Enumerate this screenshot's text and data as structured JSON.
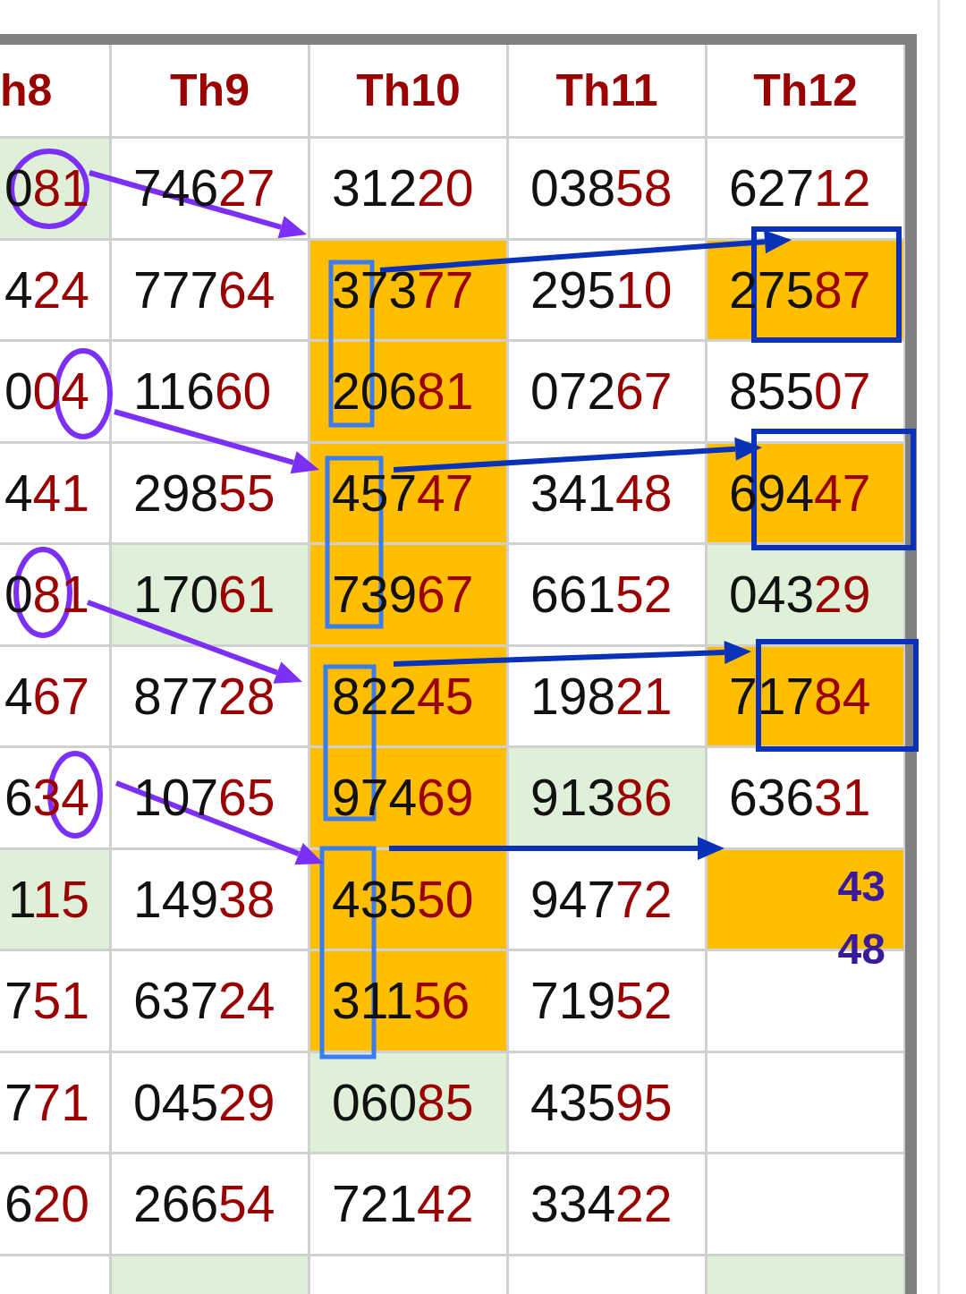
{
  "table": {
    "columns": [
      {
        "label": "h8"
      },
      {
        "label": "Th9"
      },
      {
        "label": "Th10"
      },
      {
        "label": "Th11"
      },
      {
        "label": "Th12"
      }
    ],
    "rows": [
      {
        "cells": [
          {
            "kind": "number",
            "text": "081",
            "color": "#dff0d8"
          },
          {
            "kind": "number",
            "text": "74627"
          },
          {
            "kind": "number",
            "text": "31220"
          },
          {
            "kind": "number",
            "text": "03858"
          },
          {
            "kind": "number",
            "text": "62712"
          }
        ]
      },
      {
        "cells": [
          {
            "kind": "number",
            "text": "424"
          },
          {
            "kind": "number",
            "text": "77764"
          },
          {
            "kind": "number",
            "text": "37377",
            "color": "#ffbf00"
          },
          {
            "kind": "number",
            "text": "29510"
          },
          {
            "kind": "number",
            "text": "27587",
            "color": "#ffbf00"
          }
        ]
      },
      {
        "cells": [
          {
            "kind": "number",
            "text": "004"
          },
          {
            "kind": "number",
            "text": "11660"
          },
          {
            "kind": "number",
            "text": "20681",
            "color": "#ffbf00"
          },
          {
            "kind": "number",
            "text": "07267"
          },
          {
            "kind": "number",
            "text": "85507"
          }
        ]
      },
      {
        "cells": [
          {
            "kind": "number",
            "text": "441"
          },
          {
            "kind": "number",
            "text": "29855"
          },
          {
            "kind": "number",
            "text": "45747",
            "color": "#ffbf00"
          },
          {
            "kind": "number",
            "text": "34148"
          },
          {
            "kind": "number",
            "text": "69447",
            "color": "#ffbf00"
          }
        ]
      },
      {
        "cells": [
          {
            "kind": "number",
            "text": "081"
          },
          {
            "kind": "number",
            "text": "17061",
            "color": "#dff0d8"
          },
          {
            "kind": "number",
            "text": "73967",
            "color": "#ffbf00"
          },
          {
            "kind": "number",
            "text": "66152"
          },
          {
            "kind": "number",
            "text": "04329",
            "color": "#dff0d8"
          }
        ]
      },
      {
        "cells": [
          {
            "kind": "number",
            "text": "467"
          },
          {
            "kind": "number",
            "text": "87728"
          },
          {
            "kind": "number",
            "text": "82245",
            "color": "#ffbf00"
          },
          {
            "kind": "number",
            "text": "19821"
          },
          {
            "kind": "number",
            "text": "71784",
            "color": "#ffbf00"
          }
        ]
      },
      {
        "cells": [
          {
            "kind": "number",
            "text": "634"
          },
          {
            "kind": "number",
            "text": "10765"
          },
          {
            "kind": "number",
            "text": "97469",
            "color": "#ffbf00"
          },
          {
            "kind": "number",
            "text": "91386",
            "color": "#dff0d8"
          },
          {
            "kind": "number",
            "text": "63631"
          }
        ]
      },
      {
        "cells": [
          {
            "kind": "number",
            "text": "115",
            "color": "#dff0d8"
          },
          {
            "kind": "number",
            "text": "14938"
          },
          {
            "kind": "number",
            "text": "43550",
            "color": "#ffbf00"
          },
          {
            "kind": "number",
            "text": "94772"
          },
          {
            "kind": "note",
            "text": "43 48",
            "color": "#ffbf00"
          }
        ]
      },
      {
        "cells": [
          {
            "kind": "number",
            "text": "751"
          },
          {
            "kind": "number",
            "text": "63724"
          },
          {
            "kind": "number",
            "text": "31156",
            "color": "#ffbf00"
          },
          {
            "kind": "number",
            "text": "71952"
          },
          {
            "kind": "empty"
          }
        ]
      },
      {
        "cells": [
          {
            "kind": "number",
            "text": "771"
          },
          {
            "kind": "number",
            "text": "04529"
          },
          {
            "kind": "number",
            "text": "06085",
            "color": "#dff0d8"
          },
          {
            "kind": "number",
            "text": "43595"
          },
          {
            "kind": "empty"
          }
        ]
      },
      {
        "cells": [
          {
            "kind": "number",
            "text": "620"
          },
          {
            "kind": "number",
            "text": "26654"
          },
          {
            "kind": "number",
            "text": "72142"
          },
          {
            "kind": "number",
            "text": "33422"
          },
          {
            "kind": "empty"
          }
        ]
      },
      {
        "cells": [
          {
            "kind": "empty"
          },
          {
            "kind": "empty",
            "color": "#dff0d8"
          },
          {
            "kind": "empty"
          },
          {
            "kind": "empty"
          },
          {
            "kind": "empty",
            "color": "#dff0d8"
          }
        ]
      }
    ]
  }
}
